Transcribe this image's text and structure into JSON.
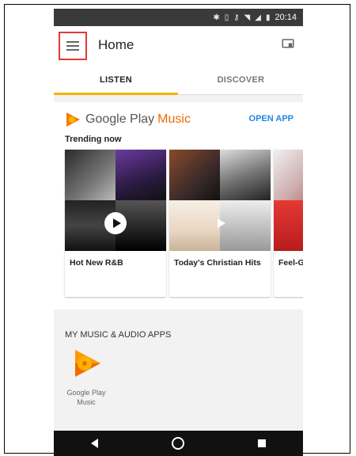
{
  "status_bar": {
    "time": "20:14"
  },
  "app_bar": {
    "title": "Home"
  },
  "tabs": [
    {
      "label": "LISTEN",
      "active": true
    },
    {
      "label": "DISCOVER",
      "active": false
    }
  ],
  "card": {
    "brand": {
      "google": "Google Play",
      "music": "Music"
    },
    "open_app": "OPEN APP",
    "section_title": "Trending now",
    "playlists": [
      {
        "label": "Hot New R&B"
      },
      {
        "label": "Today's Christian Hits"
      },
      {
        "label": "Feel-G"
      }
    ]
  },
  "apps_section": {
    "header": "MY MUSIC & AUDIO APPS",
    "apps": [
      {
        "label": "Google Play Music"
      }
    ]
  },
  "colors": {
    "accent_tab": "#f5b400",
    "link_blue": "#1e88e5",
    "brand_orange": "#ef6c00",
    "highlight_red": "#e53935"
  }
}
